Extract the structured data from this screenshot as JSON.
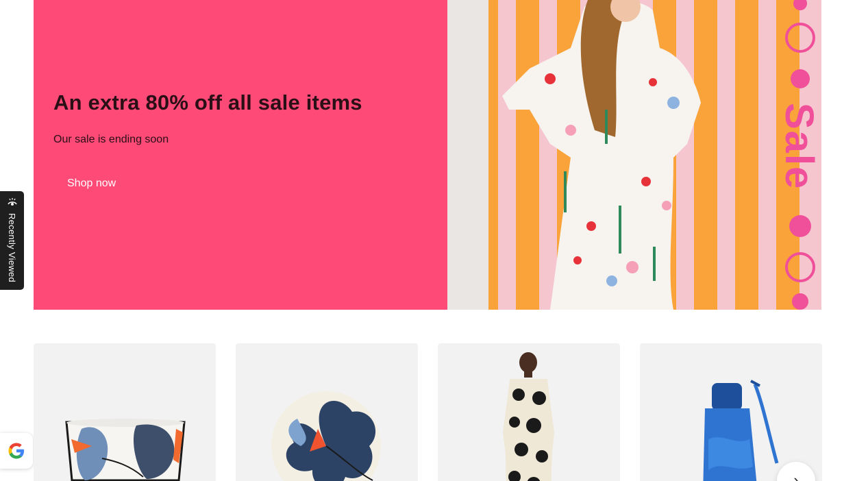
{
  "hero": {
    "title": "An extra 80% off all sale items",
    "subtitle": "Our sale is ending soon",
    "cta_label": "Shop now",
    "sale_graphic_text": "Sale",
    "background_color": "#fd4a77"
  },
  "recently_viewed": {
    "label": "Recently Viewed",
    "icon": "eye-sparkle-icon"
  },
  "google_badge": {
    "icon": "google-g-icon"
  },
  "products": [
    {
      "image": "Floral print bowl"
    },
    {
      "image": "Floral print plate"
    },
    {
      "image": "Unikko print dress"
    },
    {
      "image": "Blue umbrella"
    }
  ],
  "carousel": {
    "next_icon": "chevron-right-icon"
  },
  "colors": {
    "hero_pink": "#fd4a77",
    "card_bg": "#f2f2f2",
    "tab_dark": "#1f1f1f"
  }
}
